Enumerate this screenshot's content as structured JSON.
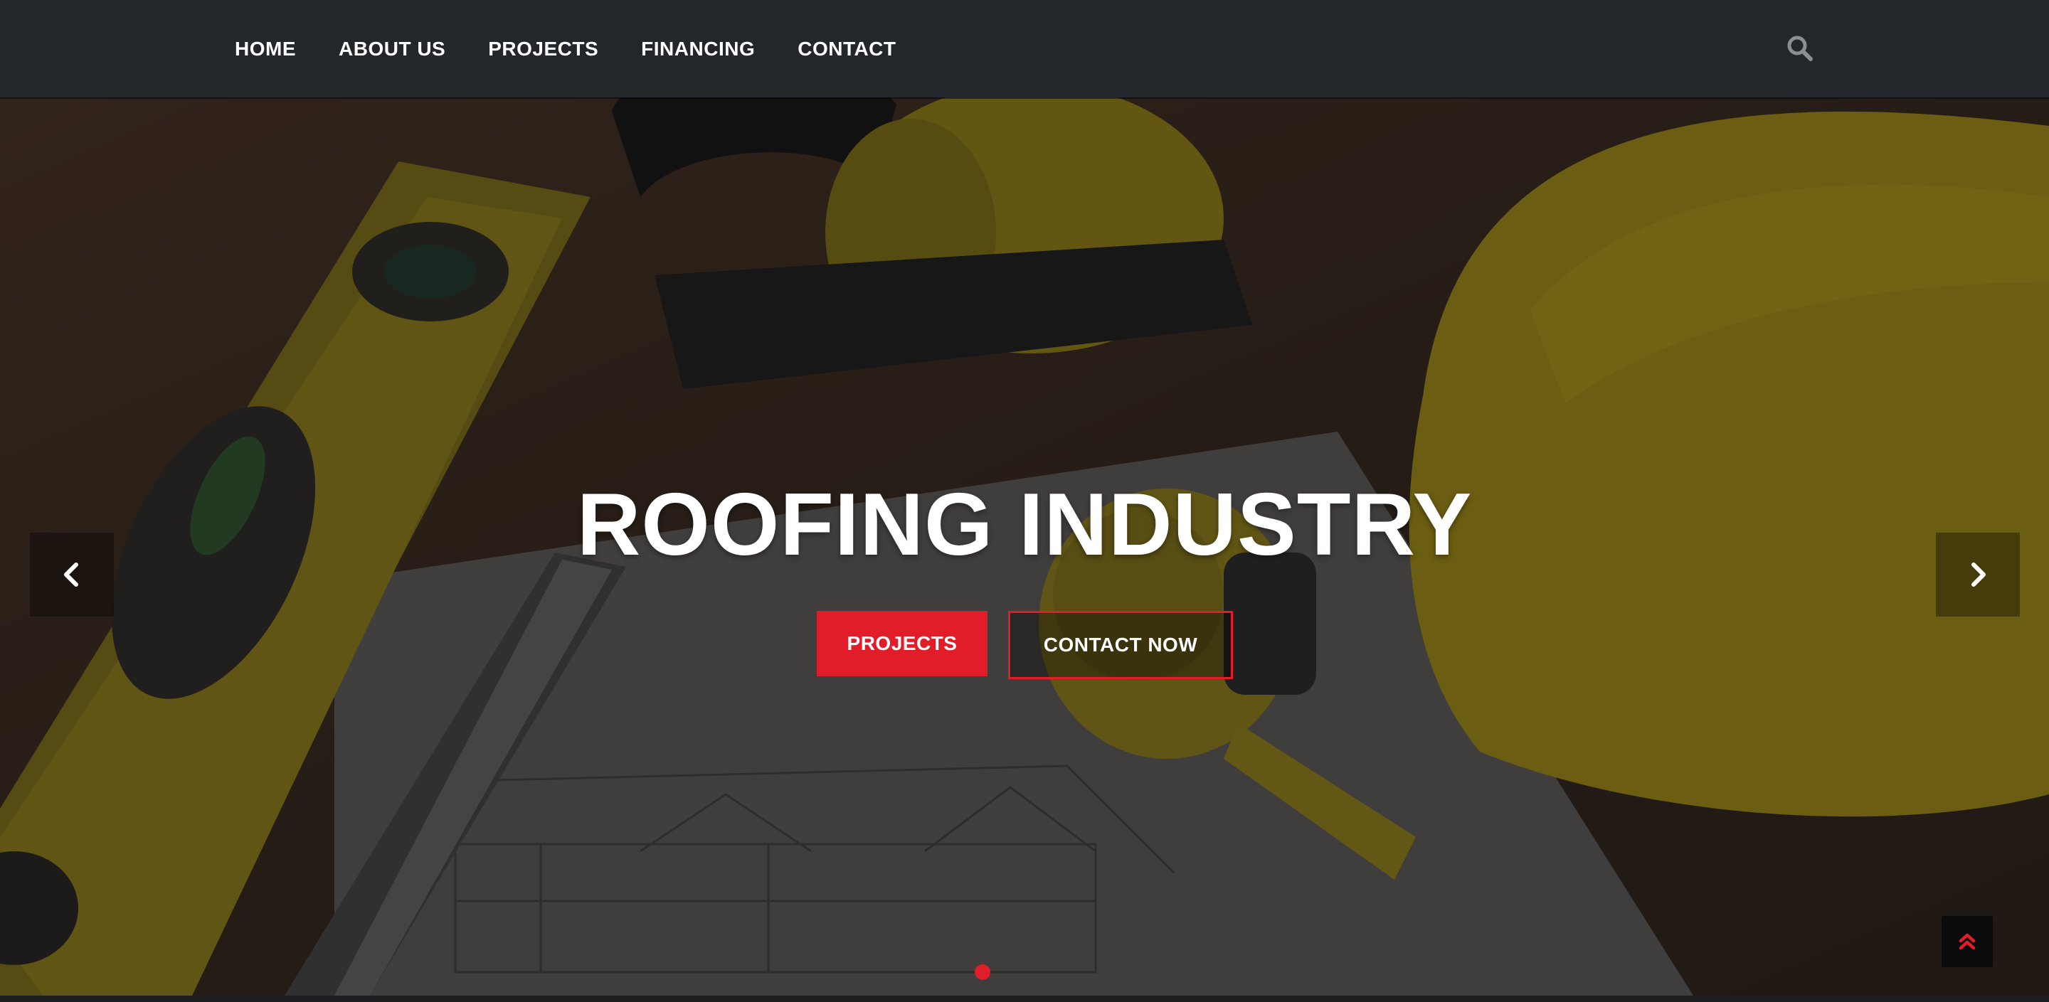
{
  "nav": {
    "items": [
      {
        "label": "HOME"
      },
      {
        "label": "ABOUT US"
      },
      {
        "label": "PROJECTS"
      },
      {
        "label": "FINANCING"
      },
      {
        "label": "CONTACT"
      }
    ],
    "search_icon": "search-icon"
  },
  "hero": {
    "title": "ROOFING INDUSTRY",
    "primary_button": "PROJECTS",
    "secondary_button": "CONTACT NOW",
    "prev_icon": "chevron-left-icon",
    "next_icon": "chevron-right-icon",
    "slides": 1,
    "active_slide": 1
  },
  "scroll_top_icon": "double-chevron-up-icon",
  "colors": {
    "accent": "#e11d2a",
    "navbar": "#23272b",
    "text": "#ffffff"
  }
}
